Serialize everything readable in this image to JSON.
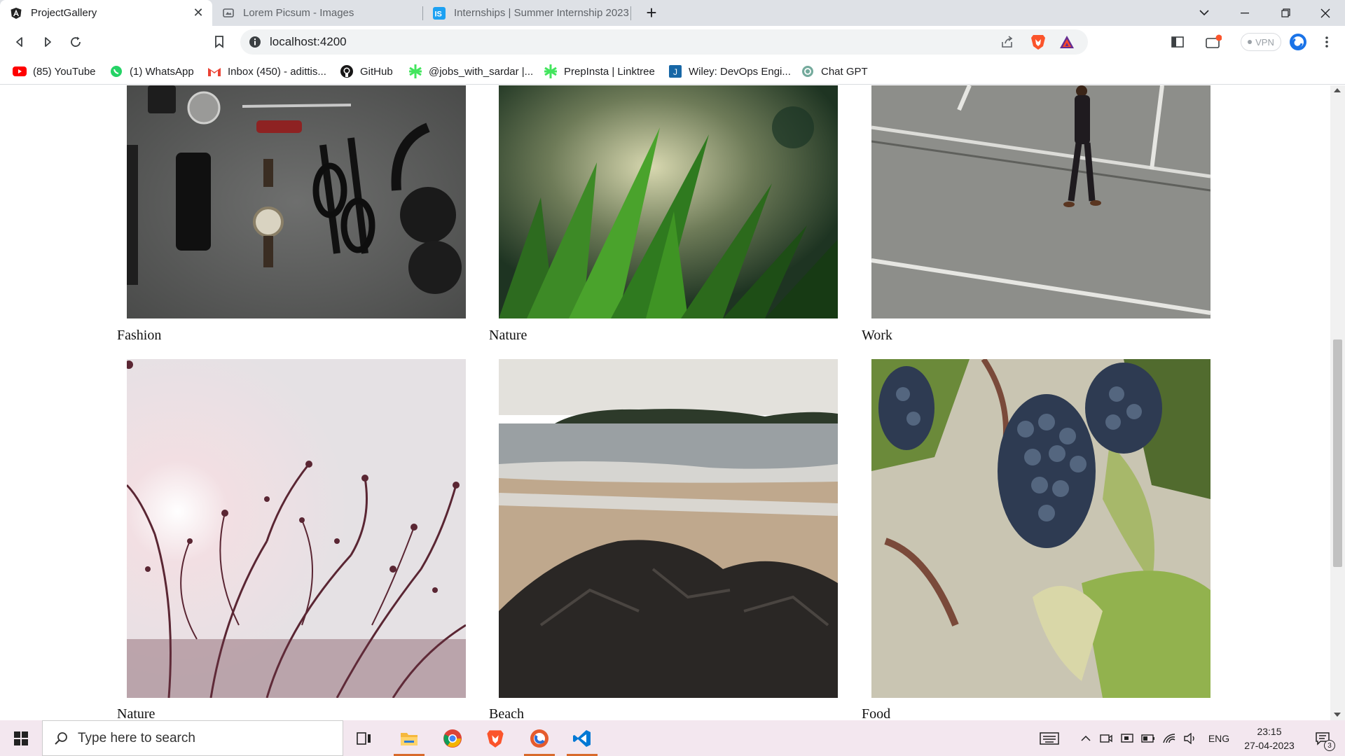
{
  "browser": {
    "tabs": [
      {
        "title": "ProjectGallery",
        "icon": "angular-icon",
        "active": true
      },
      {
        "title": "Lorem Picsum - Images",
        "icon": "page-icon",
        "active": false
      },
      {
        "title": "Internships | Summer Internship 2023",
        "icon": "internshala-icon",
        "active": false
      }
    ],
    "url": "localhost:4200",
    "vpn_label": "VPN",
    "bookmarks": [
      {
        "label": "(85) YouTube",
        "icon": "youtube-icon"
      },
      {
        "label": "(1) WhatsApp",
        "icon": "whatsapp-icon"
      },
      {
        "label": "Inbox (450) - adittis...",
        "icon": "gmail-icon"
      },
      {
        "label": "GitHub",
        "icon": "github-icon"
      },
      {
        "label": "@jobs_with_sardar |...",
        "icon": "linktree-icon"
      },
      {
        "label": "PrepInsta | Linktree",
        "icon": "linktree-icon"
      },
      {
        "label": "Wiley: DevOps Engi...",
        "icon": "wiley-icon"
      },
      {
        "label": "Chat GPT",
        "icon": "chatgpt-icon"
      }
    ]
  },
  "gallery": {
    "items": [
      {
        "caption": "Fashion",
        "image": "desk flat-lay with phone, watch, glasses and headphones"
      },
      {
        "caption": "Nature",
        "image": "close-up of green grass blades"
      },
      {
        "caption": "Work",
        "image": "man in suit walking across asphalt road"
      },
      {
        "caption": "Nature",
        "image": "silhouetted branches against bright sky"
      },
      {
        "caption": "Beach",
        "image": "sandy beach with dark rocks and distant island"
      },
      {
        "caption": "Food",
        "image": "bunch of dark grapes on the vine"
      }
    ]
  },
  "taskbar": {
    "search_placeholder": "Type here to search",
    "language": "ENG",
    "time": "23:15",
    "date": "27-04-2023",
    "notification_count": "3"
  }
}
